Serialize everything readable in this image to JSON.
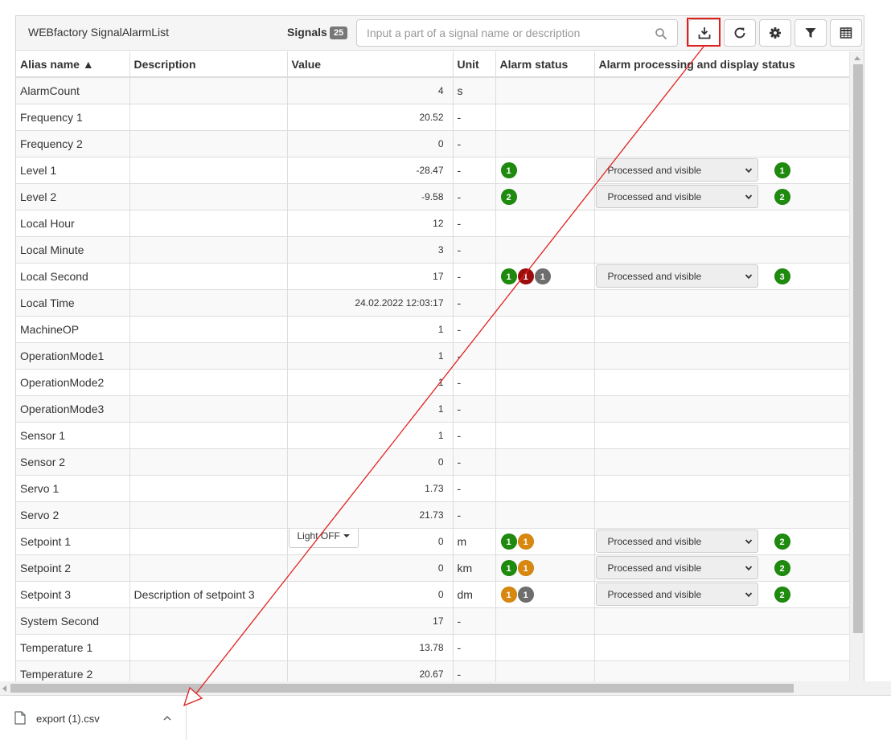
{
  "app": {
    "title": "WEBfactory SignalAlarmList",
    "signals_label": "Signals",
    "signals_count": "25"
  },
  "search": {
    "placeholder": "Input a part of a signal name or description",
    "value": ""
  },
  "toolbar": {
    "icons": [
      "download-icon",
      "refresh-icon",
      "gear-icon",
      "filter-icon",
      "table-icon"
    ]
  },
  "table": {
    "columns": [
      {
        "label": "Alias name ▲"
      },
      {
        "label": "Description"
      },
      {
        "label": "Value"
      },
      {
        "label": "Unit"
      },
      {
        "label": "Alarm status"
      },
      {
        "label": "Alarm processing and display status"
      }
    ],
    "rows": [
      {
        "alias": "AlarmCount",
        "description": "",
        "value": "4",
        "unit": "s",
        "alarms": [],
        "processing": "",
        "processing_count": ""
      },
      {
        "alias": "Frequency 1",
        "description": "",
        "value": "20.52",
        "unit": "-",
        "alarms": [],
        "processing": "",
        "processing_count": ""
      },
      {
        "alias": "Frequency 2",
        "description": "",
        "value": "0",
        "unit": "-",
        "alarms": [],
        "processing": "",
        "processing_count": ""
      },
      {
        "alias": "Level 1",
        "description": "",
        "value": "-28.47",
        "unit": "-",
        "alarms": [
          {
            "count": "1",
            "color": "green"
          }
        ],
        "processing": "Processed and visible",
        "processing_count": "1"
      },
      {
        "alias": "Level 2",
        "description": "",
        "value": "-9.58",
        "unit": "-",
        "alarms": [
          {
            "count": "2",
            "color": "green"
          }
        ],
        "processing": "Processed and visible",
        "processing_count": "2"
      },
      {
        "alias": "Local Hour",
        "description": "",
        "value": "12",
        "unit": "-",
        "alarms": [],
        "processing": "",
        "processing_count": ""
      },
      {
        "alias": "Local Minute",
        "description": "",
        "value": "3",
        "unit": "-",
        "alarms": [],
        "processing": "",
        "processing_count": ""
      },
      {
        "alias": "Local Second",
        "description": "",
        "value": "17",
        "unit": "-",
        "alarms": [
          {
            "count": "1",
            "color": "green"
          },
          {
            "count": "1",
            "color": "red"
          },
          {
            "count": "1",
            "color": "gray"
          }
        ],
        "processing": "Processed and visible",
        "processing_count": "3"
      },
      {
        "alias": "Local Time",
        "description": "",
        "value": "24.02.2022 12:03:17",
        "unit": "-",
        "alarms": [],
        "processing": "",
        "processing_count": ""
      },
      {
        "alias": "MachineOP",
        "description": "",
        "value": "1",
        "unit": "-",
        "alarms": [],
        "processing": "",
        "processing_count": ""
      },
      {
        "alias": "OperationMode1",
        "description": "",
        "value": "1",
        "unit": "-",
        "alarms": [],
        "processing": "",
        "processing_count": ""
      },
      {
        "alias": "OperationMode2",
        "description": "",
        "value": "1",
        "unit": "-",
        "alarms": [],
        "processing": "",
        "processing_count": ""
      },
      {
        "alias": "OperationMode3",
        "description": "",
        "value": "1",
        "unit": "-",
        "alarms": [],
        "processing": "",
        "processing_count": ""
      },
      {
        "alias": "Sensor 1",
        "description": "",
        "value": "1",
        "unit": "-",
        "alarms": [],
        "processing": "",
        "processing_count": ""
      },
      {
        "alias": "Sensor 2",
        "description": "",
        "value": "0",
        "unit": "-",
        "alarms": [],
        "processing": "",
        "processing_count": ""
      },
      {
        "alias": "Servo 1",
        "description": "",
        "value": "1.73",
        "unit": "-",
        "alarms": [],
        "processing": "",
        "processing_count": ""
      },
      {
        "alias": "Servo 2",
        "description": "",
        "value": "21.73",
        "unit": "-",
        "alarms": [],
        "processing": "",
        "processing_count": ""
      },
      {
        "alias": "Setpoint 1",
        "description": "",
        "value": "0",
        "value_dropdown": "Light OFF",
        "unit": "m",
        "alarms": [
          {
            "count": "1",
            "color": "green"
          },
          {
            "count": "1",
            "color": "orange"
          }
        ],
        "processing": "Processed and visible",
        "processing_count": "2"
      },
      {
        "alias": "Setpoint 2",
        "description": "",
        "value": "0",
        "unit": "km",
        "alarms": [
          {
            "count": "1",
            "color": "green"
          },
          {
            "count": "1",
            "color": "orange"
          }
        ],
        "processing": "Processed and visible",
        "processing_count": "2"
      },
      {
        "alias": "Setpoint 3",
        "description": "Description of setpoint 3",
        "value": "0",
        "unit": "dm",
        "alarms": [
          {
            "count": "1",
            "color": "orange"
          },
          {
            "count": "1",
            "color": "gray"
          }
        ],
        "processing": "Processed and visible",
        "processing_count": "2"
      },
      {
        "alias": "System Second",
        "description": "",
        "value": "17",
        "unit": "-",
        "alarms": [],
        "processing": "",
        "processing_count": ""
      },
      {
        "alias": "Temperature 1",
        "description": "",
        "value": "13.78",
        "unit": "-",
        "alarms": [],
        "processing": "",
        "processing_count": ""
      },
      {
        "alias": "Temperature 2",
        "description": "",
        "value": "20.67",
        "unit": "-",
        "alarms": [],
        "processing": "",
        "processing_count": ""
      }
    ]
  },
  "download_bar": {
    "file_name": "export (1).csv",
    "icons": [
      "file-icon",
      "chevron-up-icon"
    ]
  },
  "colors": {
    "badge_green": "#1e8a0e",
    "badge_red": "#9c0d0d",
    "badge_gray": "#6e6e6e",
    "badge_orange": "#d8880f",
    "annotation_red": "#e0201e"
  }
}
